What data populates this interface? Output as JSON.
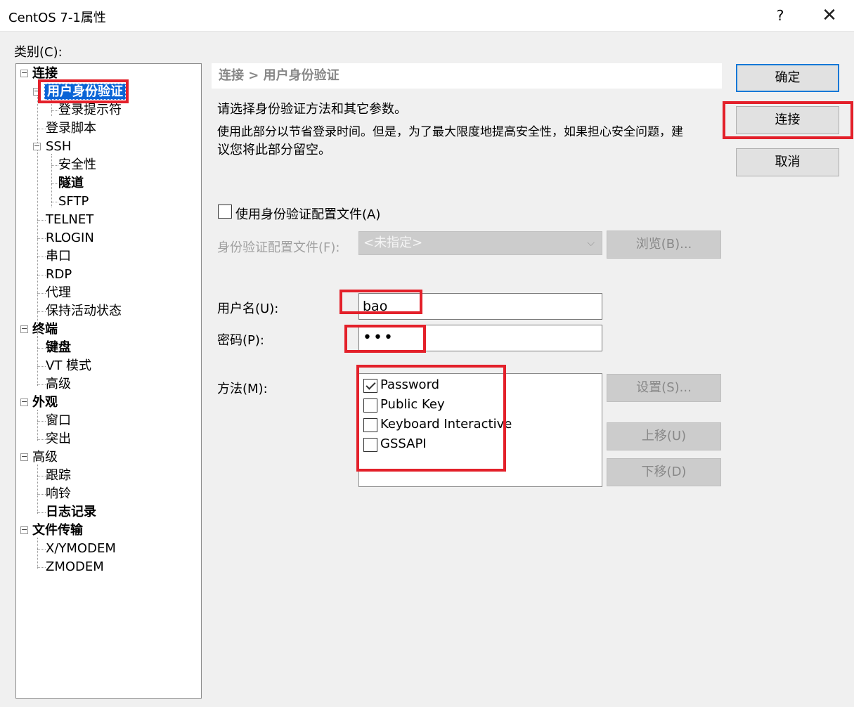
{
  "window": {
    "title": "CentOS 7-1属性",
    "help": "?",
    "close": "✕"
  },
  "category_label": "类别(C):",
  "tree": {
    "items": [
      {
        "label": "连接",
        "expander": "−"
      },
      {
        "label": "用户身份验证",
        "expander": "−",
        "selected": true
      },
      {
        "label": "登录提示符"
      },
      {
        "label": "登录脚本"
      },
      {
        "label": "SSH",
        "expander": "−"
      },
      {
        "label": "安全性"
      },
      {
        "label": "隧道"
      },
      {
        "label": "SFTP"
      },
      {
        "label": "TELNET"
      },
      {
        "label": "RLOGIN"
      },
      {
        "label": "串口"
      },
      {
        "label": "RDP"
      },
      {
        "label": "代理"
      },
      {
        "label": "保持活动状态"
      },
      {
        "label": "终端",
        "expander": "−"
      },
      {
        "label": "键盘"
      },
      {
        "label": "VT 模式"
      },
      {
        "label": "高级"
      },
      {
        "label": "外观",
        "expander": "−"
      },
      {
        "label": "窗口"
      },
      {
        "label": "突出"
      },
      {
        "label": "高级",
        "expander": "−"
      },
      {
        "label": "跟踪"
      },
      {
        "label": "响铃"
      },
      {
        "label": "日志记录"
      },
      {
        "label": "文件传输",
        "expander": "−"
      },
      {
        "label": "X/YMODEM"
      },
      {
        "label": "ZMODEM"
      }
    ]
  },
  "section": {
    "header": "连接 > 用户身份验证",
    "desc1": "请选择身份验证方法和其它参数。",
    "desc2_line1": "使用此部分以节省登录时间。但是，为了最大限度地提高安全性，如果担心安全问题，建",
    "desc2_line2": "议您将此部分留空。"
  },
  "profile": {
    "checkbox_label": "使用身份验证配置文件(A)",
    "checked": false,
    "file_label": "身份验证配置文件(F):",
    "file_value": "<未指定>",
    "browse": "浏览(B)..."
  },
  "credentials": {
    "username_label": "用户名(U):",
    "username_value": "bao",
    "password_label": "密码(P):",
    "password_value": "•••"
  },
  "methods": {
    "label": "方法(M):",
    "items": [
      {
        "label": "Password",
        "checked": true
      },
      {
        "label": "Public Key",
        "checked": false
      },
      {
        "label": "Keyboard Interactive",
        "checked": false
      },
      {
        "label": "GSSAPI",
        "checked": false
      }
    ],
    "settings": "设置(S)...",
    "move_up": "上移(U)",
    "move_down": "下移(D)"
  },
  "buttons": {
    "ok": "确定",
    "connect": "连接",
    "cancel": "取消"
  },
  "colors": {
    "highlight_box": "#e3202a",
    "selection": "#0a64d6"
  }
}
